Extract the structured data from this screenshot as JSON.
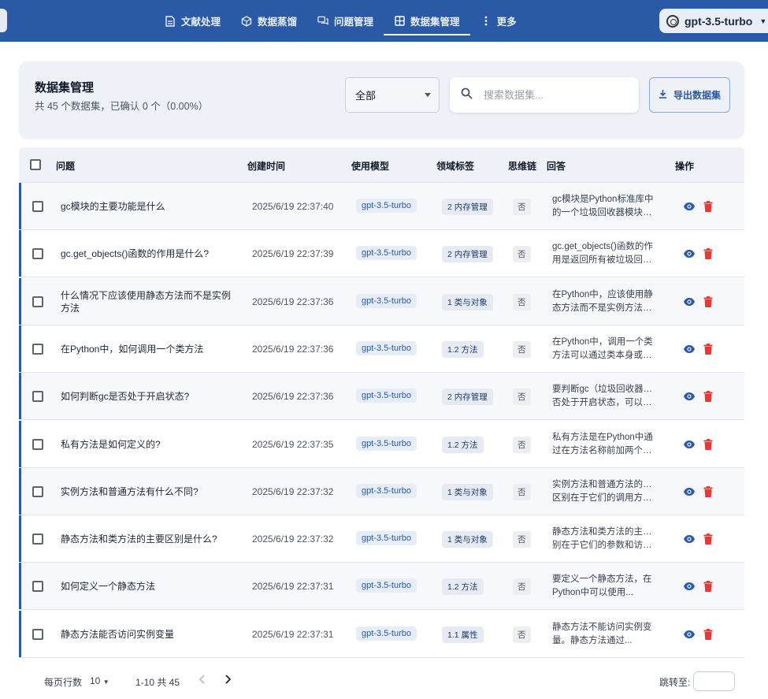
{
  "nav": {
    "tabs": [
      {
        "label": "文献处理",
        "icon": "document-icon",
        "active": false
      },
      {
        "label": "数据蒸馏",
        "icon": "cube-icon",
        "active": false
      },
      {
        "label": "问题管理",
        "icon": "chat-icon",
        "active": false
      },
      {
        "label": "数据集管理",
        "icon": "grid-icon",
        "active": true
      },
      {
        "label": "更多",
        "icon": "more-vertical-icon",
        "active": false
      }
    ],
    "model": "gpt-3.5-turbo"
  },
  "header": {
    "title": "数据集管理",
    "subtitle": "共 45 个数据集，已确认 0 个（0.00%）",
    "filter_value": "全部",
    "search_placeholder": "搜索数据集...",
    "export_label": "导出数据集"
  },
  "table": {
    "columns": [
      "问题",
      "创建时间",
      "使用模型",
      "领域标签",
      "思维链",
      "回答",
      "操作"
    ],
    "rows": [
      {
        "question": "gc模块的主要功能是什么",
        "time": "2025/6/19 22:37:40",
        "model": "gpt-3.5-turbo",
        "tag": "2 内存管理",
        "cot": "否",
        "answer_l1": "gc模块是Python标准库中",
        "answer_l2": "的一个垃圾回收器模块，..."
      },
      {
        "question": "gc.get_objects()函数的作用是什么?",
        "time": "2025/6/19 22:37:39",
        "model": "gpt-3.5-turbo",
        "tag": "2 内存管理",
        "cot": "否",
        "answer_l1": "gc.get_objects()函数的作",
        "answer_l2": "用是返回所有被垃圾回收..."
      },
      {
        "question": "什么情况下应该使用静态方法而不是实例方法",
        "time": "2025/6/19 22:37:36",
        "model": "gpt-3.5-turbo",
        "tag": "1 类与对象",
        "cot": "否",
        "answer_l1": "在Python中，应该使用静",
        "answer_l2": "态方法而不是实例方法的..."
      },
      {
        "question": "在Python中，如何调用一个类方法",
        "time": "2025/6/19 22:37:36",
        "model": "gpt-3.5-turbo",
        "tag": "1.2 方法",
        "cot": "否",
        "answer_l1": "在Python中，调用一个类",
        "answer_l2": "方法可以通过类本身或者..."
      },
      {
        "question": "如何判断gc是否处于开启状态?",
        "time": "2025/6/19 22:37:36",
        "model": "gpt-3.5-turbo",
        "tag": "2 内存管理",
        "cot": "否",
        "answer_l1": "要判断gc（垃圾回收器）是",
        "answer_l2": "否处于开启状态，可以使..."
      },
      {
        "question": "私有方法是如何定义的?",
        "time": "2025/6/19 22:37:35",
        "model": "gpt-3.5-turbo",
        "tag": "1.2 方法",
        "cot": "否",
        "answer_l1": "私有方法是在Python中通",
        "answer_l2": "过在方法名称前加两个下..."
      },
      {
        "question": "实例方法和普通方法有什么不同?",
        "time": "2025/6/19 22:37:32",
        "model": "gpt-3.5-turbo",
        "tag": "1 类与对象",
        "cot": "否",
        "answer_l1": "实例方法和普通方法的主要",
        "answer_l2": "区别在于它们的调用方式..."
      },
      {
        "question": "静态方法和类方法的主要区别是什么?",
        "time": "2025/6/19 22:37:32",
        "model": "gpt-3.5-turbo",
        "tag": "1 类与对象",
        "cot": "否",
        "answer_l1": "静态方法和类方法的主要区",
        "answer_l2": "别在于它们的参数和访问..."
      },
      {
        "question": "如何定义一个静态方法",
        "time": "2025/6/19 22:37:31",
        "model": "gpt-3.5-turbo",
        "tag": "1.2 方法",
        "cot": "否",
        "answer_l1": "要定义一个静态方法，在",
        "answer_l2": "Python中可以使用..."
      },
      {
        "question": "静态方法能否访问实例变量",
        "time": "2025/6/19 22:37:31",
        "model": "gpt-3.5-turbo",
        "tag": "1.1 属性",
        "cot": "否",
        "answer_l1": "静态方法不能访问实例变",
        "answer_l2": "量。静态方法通过..."
      }
    ]
  },
  "pagination": {
    "rows_per_page_label": "每页行数",
    "rows_per_page": "10",
    "range": "1-10 共 45",
    "goto_label": "跳转至:"
  },
  "colors": {
    "primary": "#2a5aa6",
    "delete": "#e53935"
  }
}
